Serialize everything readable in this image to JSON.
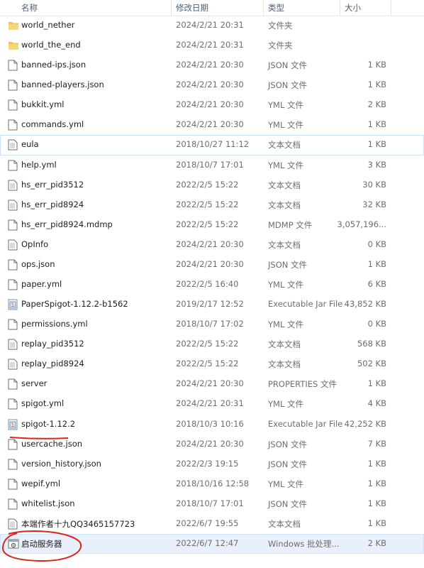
{
  "columns": {
    "name": "名称",
    "date": "修改日期",
    "type": "类型",
    "size": "大小"
  },
  "rows": [
    {
      "name": "world_nether",
      "date": "2024/2/21 20:31",
      "type": "文件夹",
      "size": "",
      "icon": "folder-icon"
    },
    {
      "name": "world_the_end",
      "date": "2024/2/21 20:31",
      "type": "文件夹",
      "size": "",
      "icon": "folder-icon"
    },
    {
      "name": "banned-ips.json",
      "date": "2024/2/21 20:30",
      "type": "JSON 文件",
      "size": "1 KB",
      "icon": "file-icon"
    },
    {
      "name": "banned-players.json",
      "date": "2024/2/21 20:30",
      "type": "JSON 文件",
      "size": "1 KB",
      "icon": "file-icon"
    },
    {
      "name": "bukkit.yml",
      "date": "2024/2/21 20:30",
      "type": "YML 文件",
      "size": "2 KB",
      "icon": "file-icon"
    },
    {
      "name": "commands.yml",
      "date": "2024/2/21 20:30",
      "type": "YML 文件",
      "size": "1 KB",
      "icon": "file-icon"
    },
    {
      "name": "eula",
      "date": "2018/10/27 11:12",
      "type": "文本文档",
      "size": "1 KB",
      "icon": "text-file-icon"
    },
    {
      "name": "help.yml",
      "date": "2018/10/7 17:01",
      "type": "YML 文件",
      "size": "3 KB",
      "icon": "file-icon"
    },
    {
      "name": "hs_err_pid3512",
      "date": "2022/2/5 15:22",
      "type": "文本文档",
      "size": "30 KB",
      "icon": "text-file-icon"
    },
    {
      "name": "hs_err_pid8924",
      "date": "2022/2/5 15:22",
      "type": "文本文档",
      "size": "32 KB",
      "icon": "text-file-icon"
    },
    {
      "name": "hs_err_pid8924.mdmp",
      "date": "2022/2/5 15:22",
      "type": "MDMP 文件",
      "size": "3,057,196...",
      "icon": "file-icon"
    },
    {
      "name": "OpInfo",
      "date": "2024/2/21 20:30",
      "type": "文本文档",
      "size": "0 KB",
      "icon": "text-file-icon"
    },
    {
      "name": "ops.json",
      "date": "2024/2/21 20:30",
      "type": "JSON 文件",
      "size": "1 KB",
      "icon": "file-icon"
    },
    {
      "name": "paper.yml",
      "date": "2022/2/5 16:40",
      "type": "YML 文件",
      "size": "6 KB",
      "icon": "file-icon"
    },
    {
      "name": "PaperSpigot-1.12.2-b1562",
      "date": "2019/2/17 12:52",
      "type": "Executable Jar File",
      "size": "43,852 KB",
      "icon": "jar-icon"
    },
    {
      "name": "permissions.yml",
      "date": "2018/10/7 17:02",
      "type": "YML 文件",
      "size": "0 KB",
      "icon": "file-icon"
    },
    {
      "name": "replay_pid3512",
      "date": "2022/2/5 15:22",
      "type": "文本文档",
      "size": "568 KB",
      "icon": "text-file-icon"
    },
    {
      "name": "replay_pid8924",
      "date": "2022/2/5 15:22",
      "type": "文本文档",
      "size": "502 KB",
      "icon": "text-file-icon"
    },
    {
      "name": "server",
      "date": "2024/2/21 20:30",
      "type": "PROPERTIES 文件",
      "size": "1 KB",
      "icon": "file-icon"
    },
    {
      "name": "spigot.yml",
      "date": "2024/2/21 20:31",
      "type": "YML 文件",
      "size": "4 KB",
      "icon": "file-icon"
    },
    {
      "name": "spigot-1.12.2",
      "date": "2018/10/3 10:16",
      "type": "Executable Jar File",
      "size": "42,252 KB",
      "icon": "jar-icon"
    },
    {
      "name": "usercache.json",
      "date": "2024/2/21 20:30",
      "type": "JSON 文件",
      "size": "7 KB",
      "icon": "file-icon"
    },
    {
      "name": "version_history.json",
      "date": "2022/2/3 19:15",
      "type": "JSON 文件",
      "size": "1 KB",
      "icon": "file-icon"
    },
    {
      "name": "wepif.yml",
      "date": "2018/10/16 12:58",
      "type": "YML 文件",
      "size": "1 KB",
      "icon": "file-icon"
    },
    {
      "name": "whitelist.json",
      "date": "2018/10/7 17:01",
      "type": "JSON 文件",
      "size": "1 KB",
      "icon": "file-icon"
    },
    {
      "name": "本端作者十九QQ3465157723",
      "date": "2022/6/7 19:55",
      "type": "文本文档",
      "size": "1 KB",
      "icon": "text-file-icon"
    },
    {
      "name": "启动服务器",
      "date": "2022/6/7 12:47",
      "type": "Windows 批处理...",
      "size": "2 KB",
      "icon": "batch-file-icon"
    }
  ],
  "colors": {
    "folder": "#f4c14e",
    "selection": "#e8f1fb",
    "annotation": "#d9251d"
  }
}
